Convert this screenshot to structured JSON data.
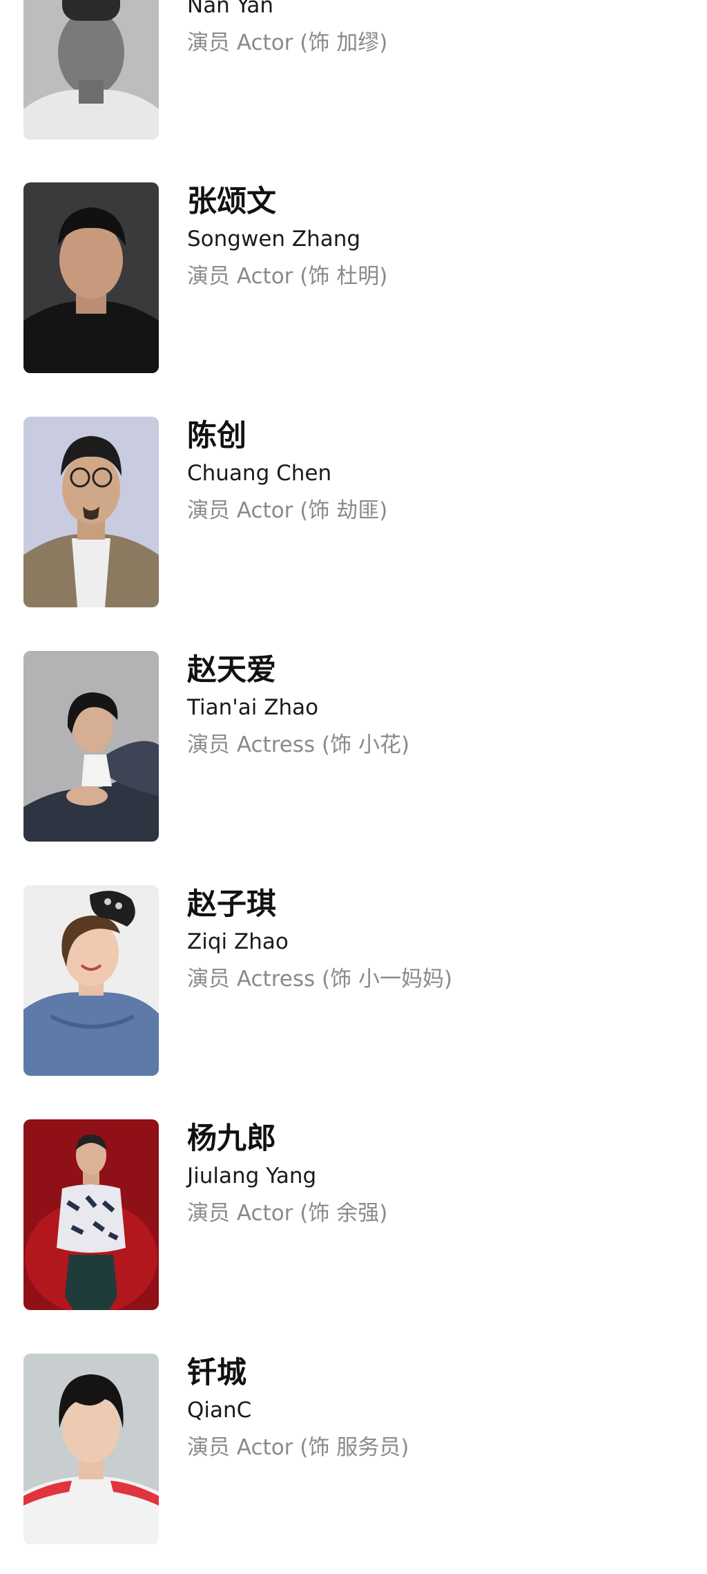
{
  "cast": [
    {
      "name_cn": "",
      "name_en": "Nan Yan",
      "role": "演员 Actor (饰 加缪)",
      "photo_icon": "portrait-photo-icon"
    },
    {
      "name_cn": "张颂文",
      "name_en": "Songwen Zhang",
      "role": "演员 Actor (饰 杜明)",
      "photo_icon": "portrait-photo-icon"
    },
    {
      "name_cn": "陈创",
      "name_en": "Chuang Chen",
      "role": "演员 Actor (饰 劫匪)",
      "photo_icon": "portrait-photo-icon"
    },
    {
      "name_cn": "赵天爱",
      "name_en": "Tian'ai Zhao",
      "role": "演员 Actress (饰 小花)",
      "photo_icon": "portrait-photo-icon"
    },
    {
      "name_cn": "赵子琪",
      "name_en": "Ziqi Zhao",
      "role": "演员 Actress (饰 小一妈妈)",
      "photo_icon": "portrait-photo-icon"
    },
    {
      "name_cn": "杨九郎",
      "name_en": "Jiulang Yang",
      "role": "演员 Actor (饰 余强)",
      "photo_icon": "portrait-photo-icon"
    },
    {
      "name_cn": "钎城",
      "name_en": "QianC",
      "role": "演员 Actor (饰 服务员)",
      "photo_icon": "portrait-photo-icon"
    }
  ],
  "colors": {
    "background": "#ffffff",
    "name_text": "#111111",
    "role_text": "#8a8a8a"
  }
}
